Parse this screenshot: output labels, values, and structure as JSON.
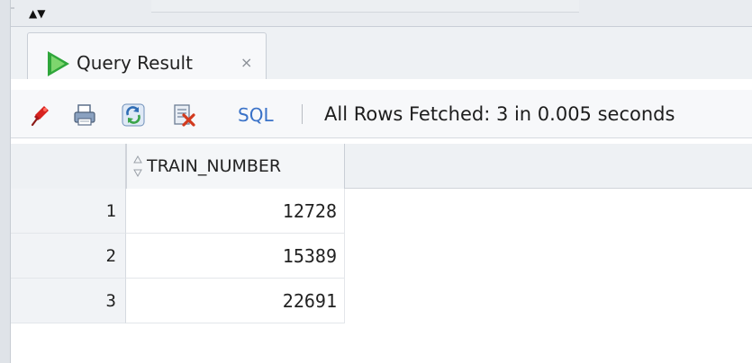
{
  "window": {
    "sort_arrows": "▲▼"
  },
  "tab": {
    "label": "Query Result",
    "close": "×",
    "icon": "run-play-icon"
  },
  "toolbar": {
    "icons": [
      "pin-icon",
      "print-icon",
      "refresh-icon",
      "delete-icon"
    ],
    "sql_label": "SQL",
    "separator": "|",
    "status": "All Rows Fetched: 3 in 0.005 seconds"
  },
  "grid": {
    "columns": [
      "TRAIN_NUMBER"
    ],
    "rows": [
      {
        "num": "1",
        "train_number": "12728"
      },
      {
        "num": "2",
        "train_number": "15389"
      },
      {
        "num": "3",
        "train_number": "22691"
      }
    ]
  },
  "colors": {
    "accent_green": "#2fa63b",
    "sql_blue": "#3a72c8",
    "pin_red": "#d8231f"
  }
}
